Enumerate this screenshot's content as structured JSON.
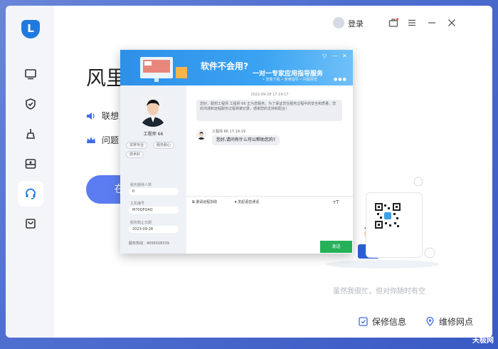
{
  "header": {
    "login_label": "登录"
  },
  "main": {
    "title": "风里",
    "features": [
      {
        "label": "联想",
        "icon": "speaker-icon"
      },
      {
        "label": "问题",
        "icon": "crown-icon"
      }
    ],
    "cta_label": "在",
    "slogan": "虽然我很忙，但对你随时有空"
  },
  "bottom": {
    "warranty_label": "保修信息",
    "repair_label": "维修网点"
  },
  "dialog": {
    "banner": {
      "title": "软件不会用?",
      "subtitle": "一对一专家应用指导服务",
      "tags": "• 安装下载 • 使用指导 • 问题排查"
    },
    "engineer": {
      "name": "工程师 66",
      "tags": [
        "非常专业",
        "服务耐心",
        "技术好"
      ],
      "served_label": "服务器待人数",
      "served_value": "0",
      "host_label": "主机编号",
      "host_value": "M70QFQ4Q",
      "expire_label": "服务截止日期",
      "expire_value": "2023-09-28",
      "hotline": "服务热线：4006508339"
    },
    "chat": {
      "timestamp": "2022-09-28 17:19:17",
      "system_msg": "您好，联想工程师 工程师 66 正为您服务。为了保证您在服务过程中的安全和质量，您的沟通和远程服务过程将被记录，感谢您的支持和配合！",
      "engineer_header": "工程师 66 17:19:19",
      "engineer_msg": "您好,请问有什么可以帮助您的?"
    },
    "tools": {
      "remote_label": "邀请远程协助",
      "voice_label": "发起语音通话"
    },
    "send_label": "发送"
  },
  "watermark": "天极网",
  "colors": {
    "accent": "#1f7ae0",
    "cta": "#5b7df1",
    "send": "#27b05a",
    "banner": "#2e8fe8"
  }
}
